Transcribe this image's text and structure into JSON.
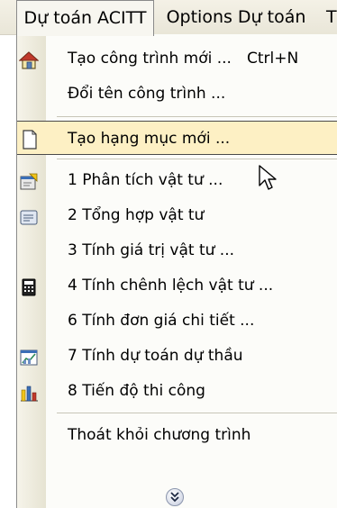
{
  "menubar": {
    "tabs": [
      {
        "label": "Dự toán ACITT"
      },
      {
        "label": "Options Dự toán"
      },
      {
        "label": "T"
      }
    ]
  },
  "menu": {
    "items": [
      {
        "label": "Tạo công trình mới ...",
        "shortcut": "Ctrl+N",
        "icon": "house-icon"
      },
      {
        "label": "Đổi tên công trình ...",
        "icon": ""
      },
      {
        "label": "Tạo hạng mục mới ...",
        "icon": "new-document-icon"
      },
      {
        "label": "1 Phân tích vật tư ...",
        "icon": "form-analysis-icon"
      },
      {
        "label": "2 Tổng hợp vật tư",
        "icon": "summary-window-icon"
      },
      {
        "label": "3 Tính giá trị vật tư ...",
        "icon": ""
      },
      {
        "label": "4 Tính chênh lệch vật tư ...",
        "icon": "calculator-icon"
      },
      {
        "label": "6 Tính đơn giá chi tiết ...",
        "icon": ""
      },
      {
        "label": "7 Tính dự toán dự thầu",
        "icon": "chart-window-icon"
      },
      {
        "label": "8 Tiến độ thi công",
        "icon": "bar-chart-icon"
      },
      {
        "label": "Thoát khỏi chương trình",
        "icon": ""
      }
    ],
    "more_icon": "double-chevron-down-icon"
  }
}
